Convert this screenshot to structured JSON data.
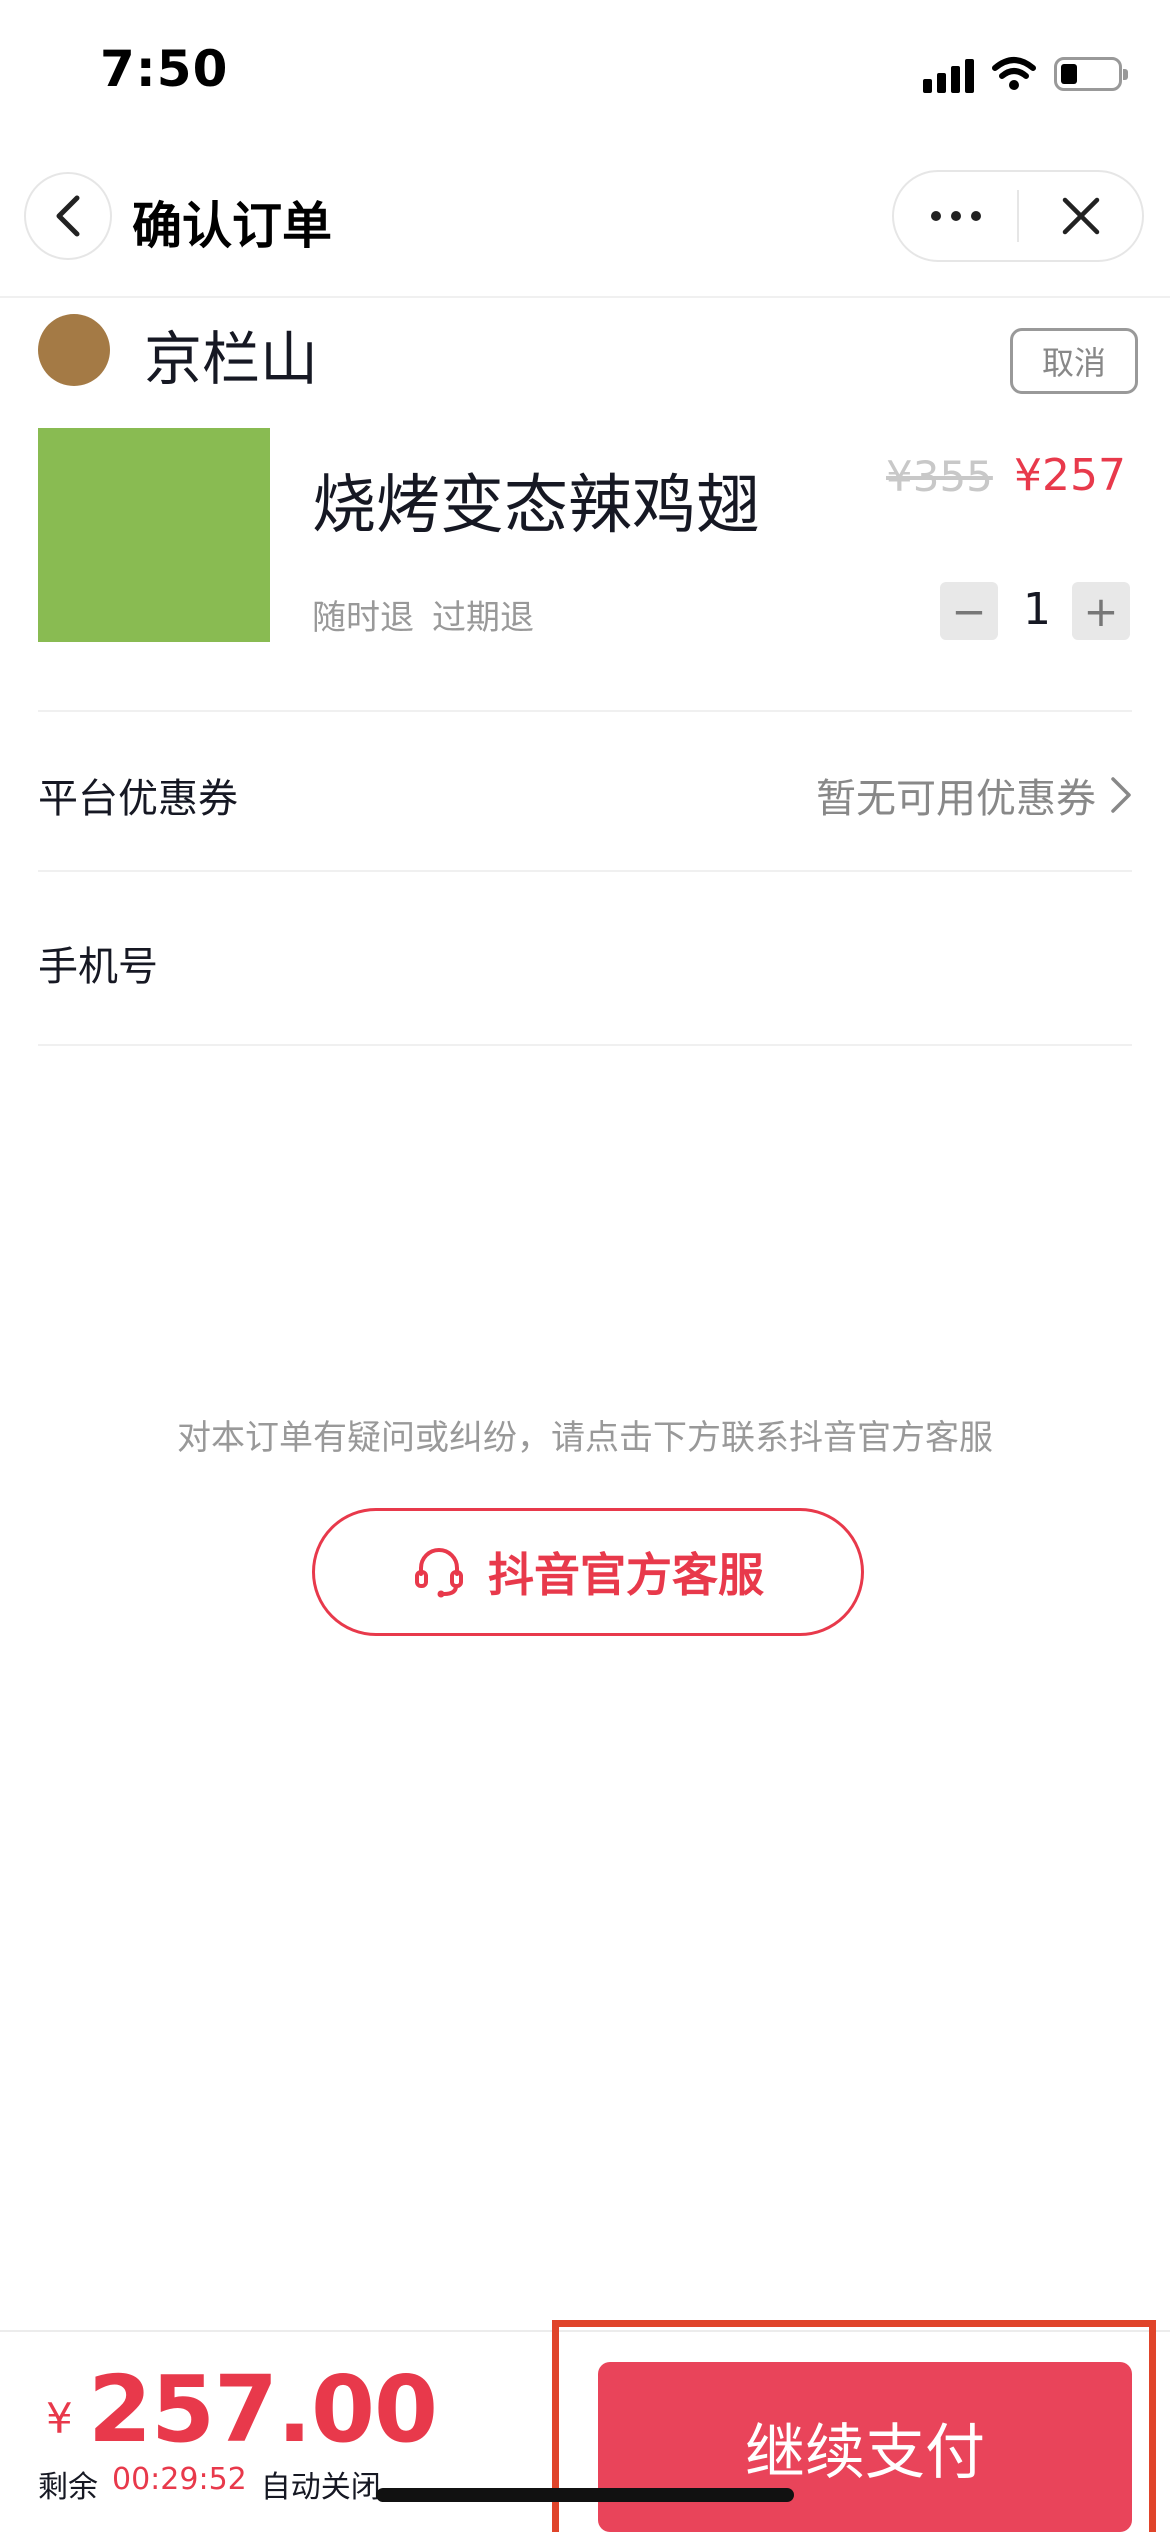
{
  "status_bar": {
    "time": "7:50"
  },
  "nav": {
    "title": "确认订单"
  },
  "shop": {
    "name": "京栏山",
    "cancel_label": "取消"
  },
  "product": {
    "name": "烧烤变态辣鸡翅",
    "original_price": "¥355",
    "sale_price": "¥257",
    "tags": [
      "随时退",
      "过期退"
    ],
    "quantity": "1",
    "minus_label": "−",
    "plus_label": "+"
  },
  "coupon": {
    "label": "平台优惠券",
    "value": "暂无可用优惠券"
  },
  "phone": {
    "label": "手机号"
  },
  "support": {
    "note": "对本订单有疑问或纠纷，请点击下方联系抖音官方客服",
    "button_label": "抖音官方客服"
  },
  "bottom": {
    "currency": "¥",
    "total": "257.00",
    "remaining_label": "剩余",
    "countdown": "00:29:52",
    "auto_close_label": "自动关闭",
    "pay_label": "继续支付"
  },
  "colors": {
    "accent": "#e8394b",
    "pay_button": "#e9445a",
    "highlight": "#e0442a"
  },
  "icons": [
    "back-chevron-icon",
    "more-icon",
    "close-icon",
    "headset-icon",
    "chevron-right-icon",
    "signal-icon",
    "wifi-icon",
    "battery-icon"
  ]
}
